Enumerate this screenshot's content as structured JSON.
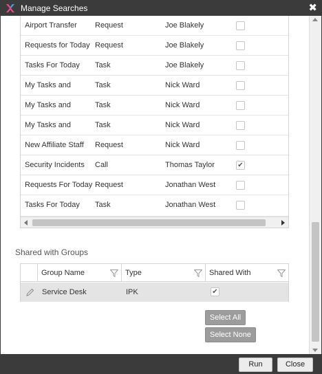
{
  "window": {
    "title": "Manage Searches"
  },
  "searches": {
    "rows": [
      {
        "name": "Airport Transfer",
        "type": "Request",
        "owner": "Joe Blakely",
        "checked": false
      },
      {
        "name": "Requests for Today",
        "type": "Request",
        "owner": "Joe Blakely",
        "checked": false
      },
      {
        "name": "Tasks For Today",
        "type": "Task",
        "owner": "Joe Blakely",
        "checked": false
      },
      {
        "name": "My Tasks and",
        "type": "Task",
        "owner": "Nick Ward",
        "checked": false
      },
      {
        "name": "My Tasks and",
        "type": "Task",
        "owner": "Nick Ward",
        "checked": false
      },
      {
        "name": "My Tasks and",
        "type": "Task",
        "owner": "Nick Ward",
        "checked": false
      },
      {
        "name": "New Affiliate Staff",
        "type": "Request",
        "owner": "Nick Ward",
        "checked": false
      },
      {
        "name": "Security Incidents",
        "type": "Call",
        "owner": "Thomas Taylor",
        "checked": true
      },
      {
        "name": "Requests For Today",
        "type": "Request",
        "owner": "Jonathan West",
        "checked": false
      },
      {
        "name": "Tasks For Today",
        "type": "Task",
        "owner": "Jonathan West",
        "checked": false
      }
    ]
  },
  "shared_groups": {
    "label": "Shared with Groups",
    "columns": [
      "Group Name",
      "Type",
      "Shared With"
    ],
    "rows": [
      {
        "name": "Service Desk",
        "type": "IPK",
        "checked": true
      }
    ],
    "select_all": "Select All",
    "select_none": "Select None"
  },
  "footer": {
    "run": "Run",
    "close": "Close"
  },
  "colors": {
    "titlebar": "#3b3b3b",
    "button_gray": "#9c9c9c",
    "selected_row": "#e4e4e4"
  }
}
